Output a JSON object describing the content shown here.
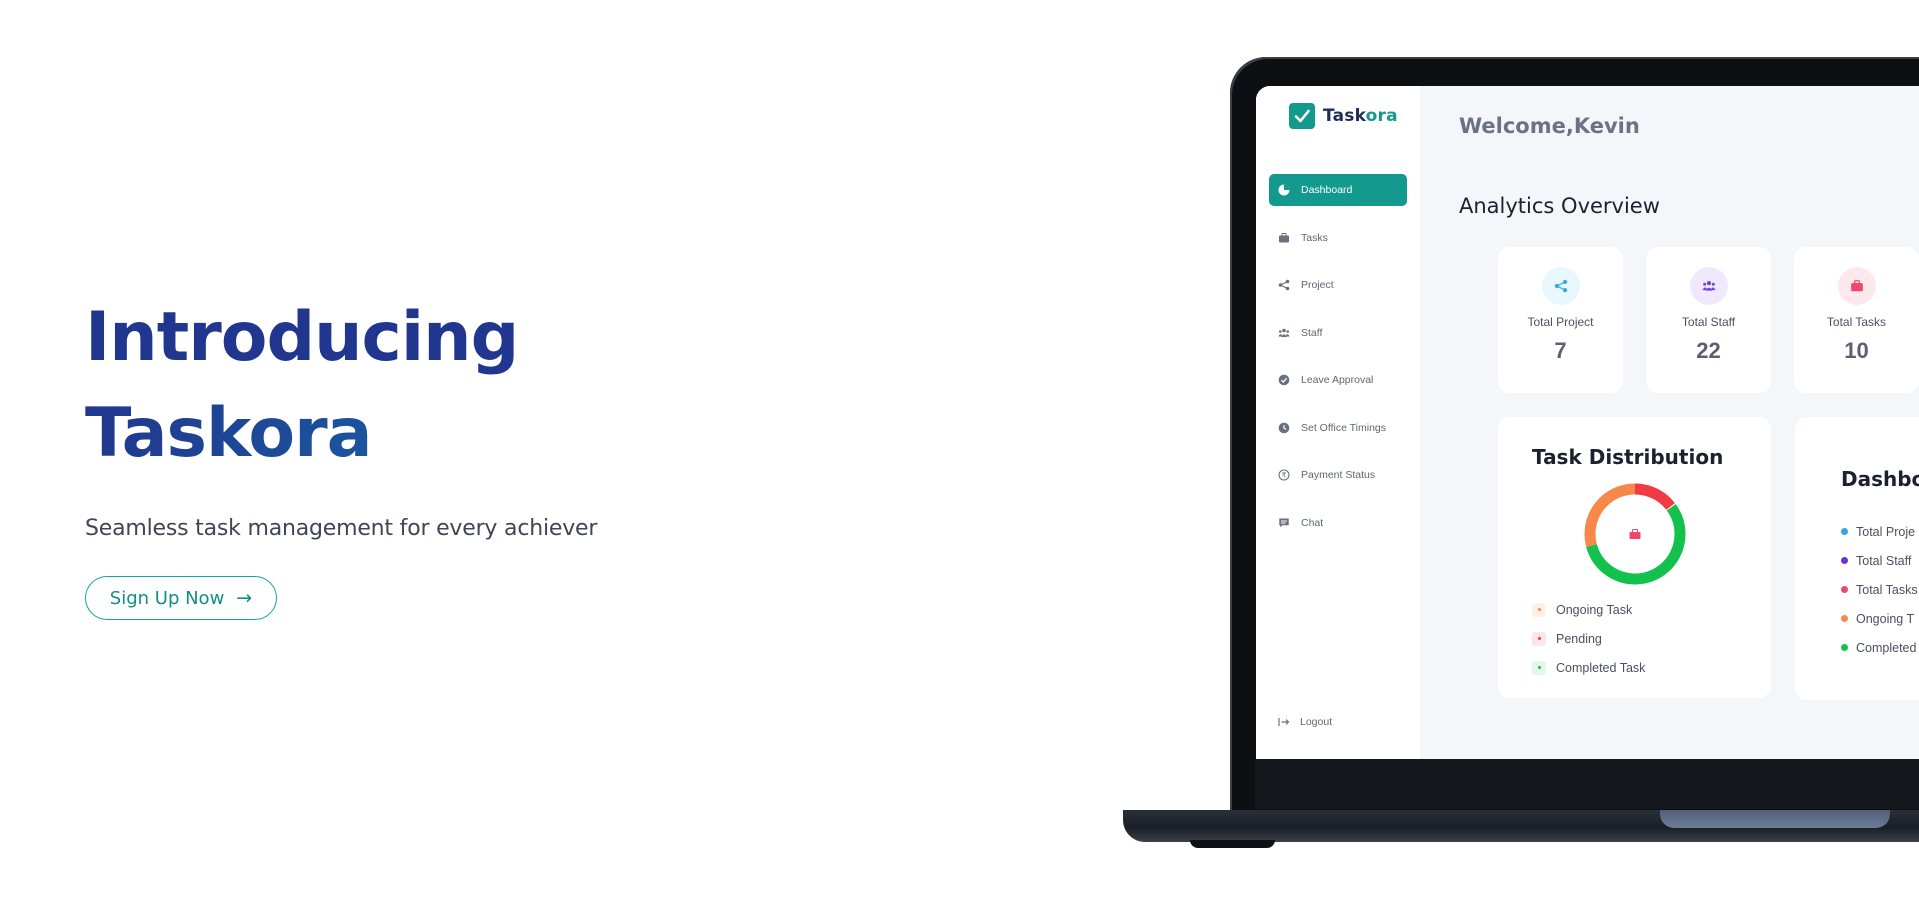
{
  "hero": {
    "title_line1": "Introducing",
    "title_line2": "Taskora",
    "subtitle": "Seamless task management for every achiever",
    "cta_label": "Sign Up Now",
    "cta_icon": "arrow-right-icon"
  },
  "app": {
    "brand": {
      "name_part1": "Task",
      "name_part2": "ora"
    },
    "sidebar": {
      "items": [
        {
          "label": "Dashboard",
          "icon": "pie-chart-icon",
          "active": true
        },
        {
          "label": "Tasks",
          "icon": "briefcase-icon"
        },
        {
          "label": "Project",
          "icon": "share-icon"
        },
        {
          "label": "Staff",
          "icon": "users-icon"
        },
        {
          "label": "Leave Approval",
          "icon": "check-circle-icon"
        },
        {
          "label": "Set Office Timings",
          "icon": "clock-icon"
        },
        {
          "label": "Payment Status",
          "icon": "rupee-icon"
        },
        {
          "label": "Chat",
          "icon": "chat-icon"
        }
      ],
      "logout_label": "Logout"
    },
    "welcome": "Welcome,Kevin",
    "overview_title": "Analytics Overview",
    "stats": [
      {
        "label": "Total Project",
        "value": "7",
        "icon": "share-icon",
        "color": "#33a9e0",
        "bg": "#e8f6fd"
      },
      {
        "label": "Total Staff",
        "value": "22",
        "icon": "users-icon",
        "color": "#7a3ee0",
        "bg": "#f0e9fd"
      },
      {
        "label": "Total Tasks",
        "value": "10",
        "icon": "briefcase-icon",
        "color": "#f0466b",
        "bg": "#fde8ee"
      }
    ],
    "task_distribution": {
      "title": "Task Distribution",
      "legend": [
        {
          "label": "Ongoing Task",
          "color": "#f7884a",
          "bg": "#fff0e6"
        },
        {
          "label": "Pending",
          "color": "#f03a44",
          "bg": "#fde6e7"
        },
        {
          "label": "Completed Task",
          "color": "#12c24c",
          "bg": "#e4f8ea"
        }
      ]
    },
    "dashboard_card": {
      "title": "Dashbo",
      "items": [
        {
          "label": "Total Proje",
          "color": "#3aa3e3"
        },
        {
          "label": "Total Staff",
          "color": "#6b2fd9"
        },
        {
          "label": "Total Tasks",
          "color": "#f0466b"
        },
        {
          "label": "Ongoing T",
          "color": "#f7884a"
        },
        {
          "label": "Completed",
          "color": "#12c24c"
        }
      ]
    }
  }
}
